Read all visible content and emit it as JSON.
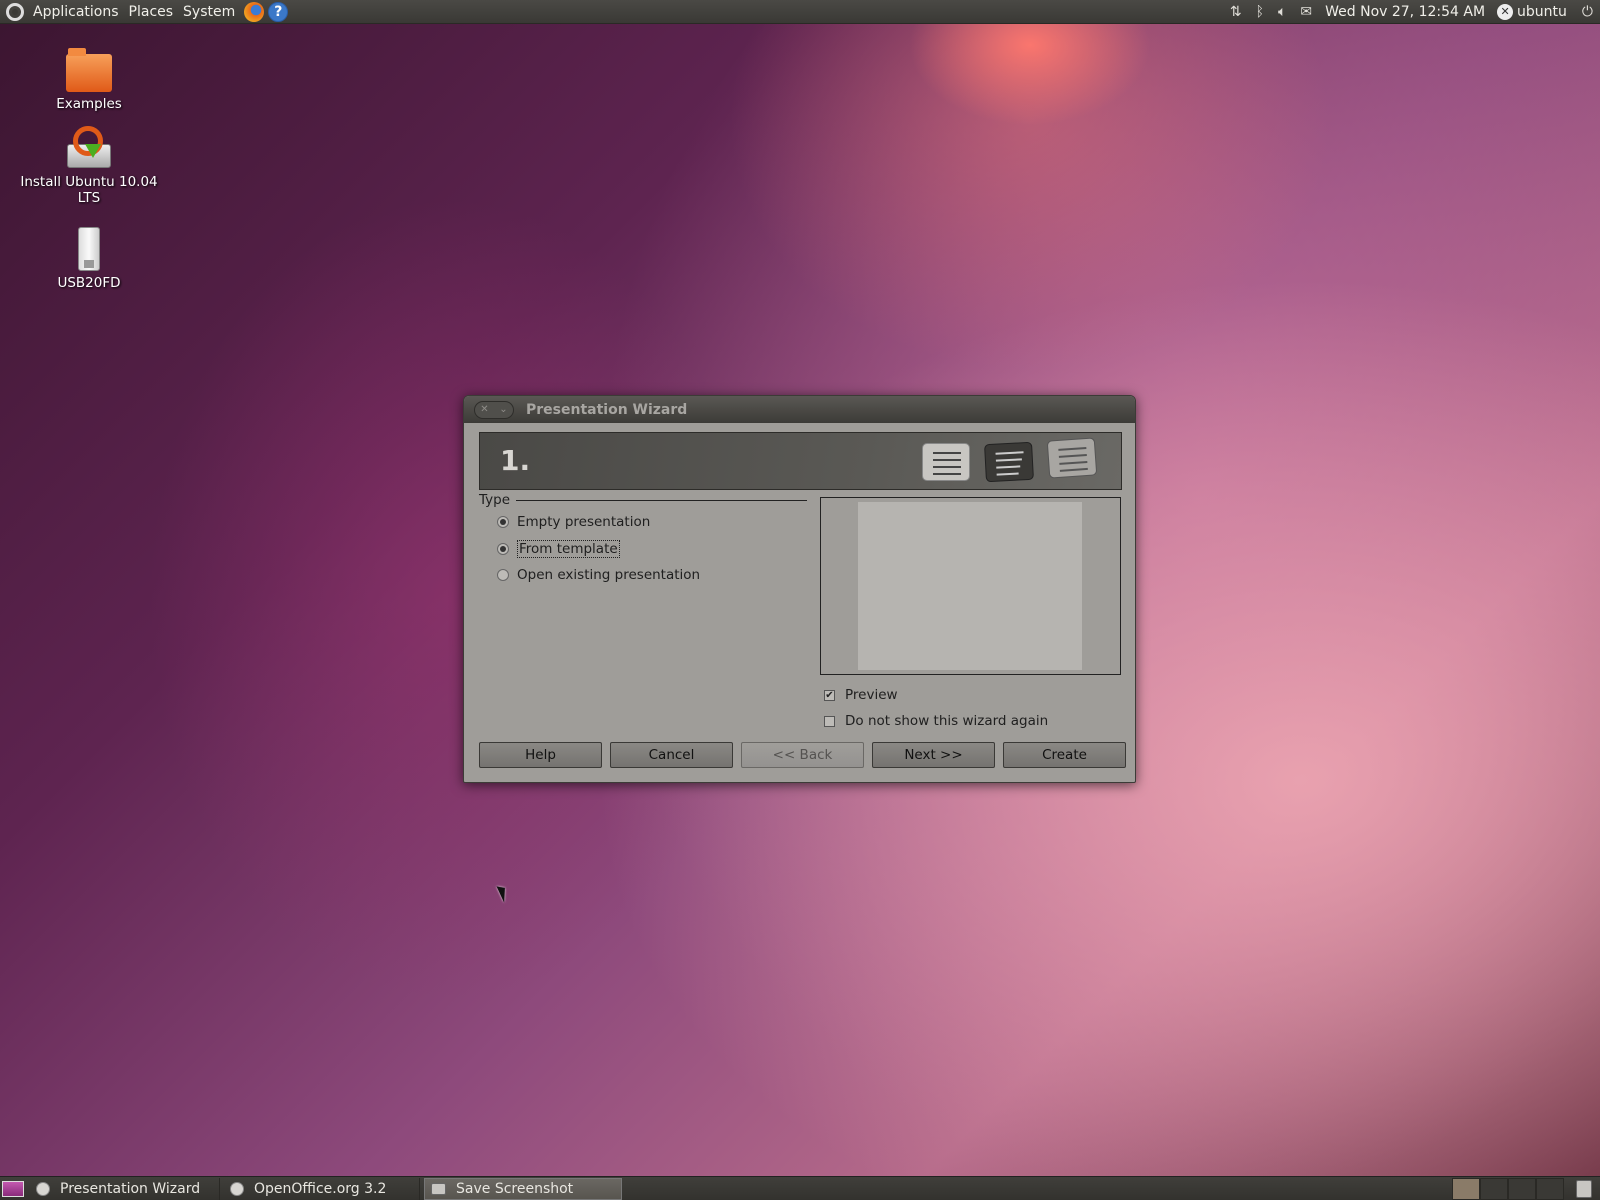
{
  "top_panel": {
    "menus": [
      "Applications",
      "Places",
      "System"
    ],
    "clock": "Wed Nov 27, 12:54 AM",
    "user": "ubuntu"
  },
  "desktop_icons": [
    {
      "label": "Examples",
      "icon": "folder-icon"
    },
    {
      "label": "Install Ubuntu 10.04 LTS",
      "icon": "installer-icon"
    },
    {
      "label": "USB20FD",
      "icon": "usb-drive-icon"
    }
  ],
  "dialog": {
    "title": "Presentation Wizard",
    "step": "1.",
    "type_label": "Type",
    "options": [
      {
        "label": "Empty presentation",
        "selected": true
      },
      {
        "label": "From template",
        "selected": true,
        "focused": true
      },
      {
        "label": "Open existing presentation",
        "selected": false
      }
    ],
    "preview_label": "Preview",
    "preview_checked": true,
    "no_show_label": "Do not show this wizard again",
    "no_show_checked": false,
    "buttons": {
      "help": "Help",
      "cancel": "Cancel",
      "back": "<< Back",
      "next": "Next >>",
      "create": "Create"
    }
  },
  "taskbar": {
    "tasks": [
      "Presentation Wizard",
      "OpenOffice.org 3.2",
      "Save Screenshot"
    ]
  }
}
